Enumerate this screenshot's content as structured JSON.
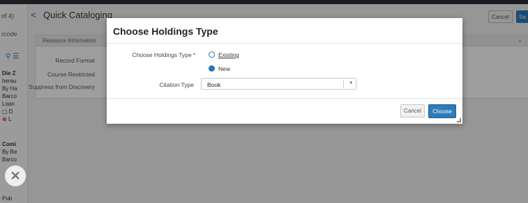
{
  "background": {
    "left_pane": {
      "count_text": "of 4)",
      "barcode_label": "rcode",
      "items": [
        {
          "title": "Die Z",
          "lines": [
            "herau",
            "By Ha",
            "Barco",
            "Loan",
            "D",
            "L"
          ]
        },
        {
          "title": "Comi",
          "lines": [
            "By Be",
            "Barco"
          ]
        }
      ],
      "bottom_text": "Pub"
    },
    "header": {
      "back_glyph": "<",
      "title": "Quick Cataloging",
      "cancel_label": "Cancel",
      "save_label": "Sa"
    },
    "panel": {
      "section_title": "Resource Information",
      "fields": [
        {
          "label": "Record Format"
        },
        {
          "label": "Course Restricted"
        },
        {
          "label": "Suppress from Discovery"
        }
      ]
    }
  },
  "modal": {
    "title": "Choose Holdings Type",
    "holdings_type_label": "Choose Holdings Type",
    "required_marker": "*",
    "options": [
      {
        "label": "Existing",
        "selected": false
      },
      {
        "label": "New",
        "selected": true
      }
    ],
    "citation_type_label": "Citation Type",
    "citation_type_value": "Book",
    "cancel_label": "Cancel",
    "choose_label": "Choose"
  },
  "colors": {
    "accent": "#2d7bb8",
    "required": "#d22222"
  }
}
